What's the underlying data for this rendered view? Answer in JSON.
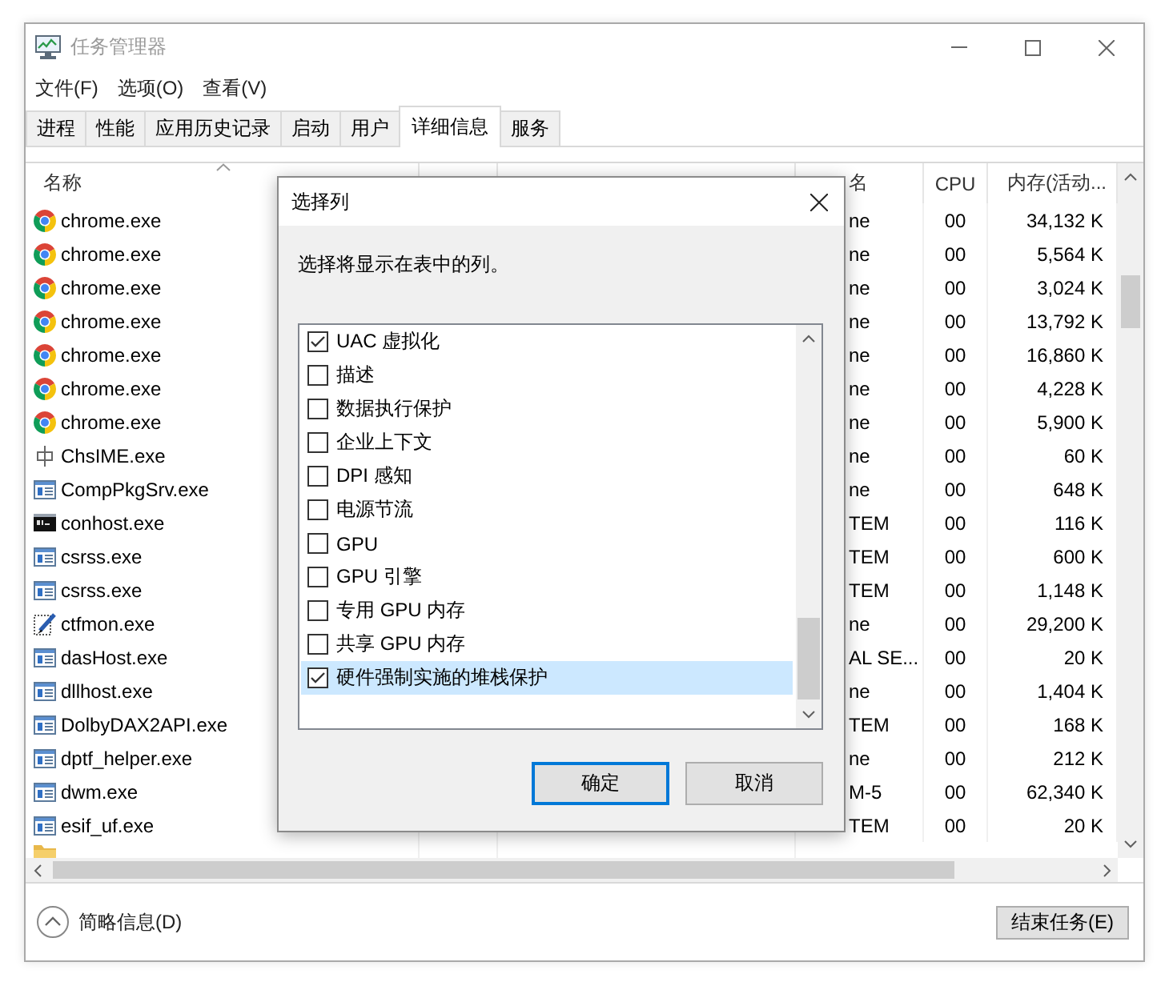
{
  "window": {
    "title": "任务管理器"
  },
  "menu": [
    "文件(F)",
    "选项(O)",
    "查看(V)"
  ],
  "tabs": [
    {
      "label": "进程",
      "selected": false
    },
    {
      "label": "性能",
      "selected": false
    },
    {
      "label": "应用历史记录",
      "selected": false
    },
    {
      "label": "启动",
      "selected": false
    },
    {
      "label": "用户",
      "selected": false
    },
    {
      "label": "详细信息",
      "selected": true
    },
    {
      "label": "服务",
      "selected": false
    }
  ],
  "table": {
    "columns": [
      {
        "label": "名称",
        "sorted": true
      },
      {
        "label": "名",
        "sorted": false
      },
      {
        "label": "CPU",
        "sorted": false
      },
      {
        "label": "内存(活动...",
        "sorted": false
      }
    ],
    "rows": [
      {
        "kind": "chrome",
        "cells": [
          "chrome.exe",
          "ne",
          "00",
          "34,132 K"
        ]
      },
      {
        "kind": "chrome",
        "cells": [
          "chrome.exe",
          "ne",
          "00",
          "5,564 K"
        ]
      },
      {
        "kind": "chrome",
        "cells": [
          "chrome.exe",
          "ne",
          "00",
          "3,024 K"
        ]
      },
      {
        "kind": "chrome",
        "cells": [
          "chrome.exe",
          "ne",
          "00",
          "13,792 K"
        ]
      },
      {
        "kind": "chrome",
        "cells": [
          "chrome.exe",
          "ne",
          "00",
          "16,860 K"
        ]
      },
      {
        "kind": "chrome",
        "cells": [
          "chrome.exe",
          "ne",
          "00",
          "4,228 K"
        ]
      },
      {
        "kind": "chrome",
        "cells": [
          "chrome.exe",
          "ne",
          "00",
          "5,900 K"
        ]
      },
      {
        "kind": "ime",
        "cells": [
          "ChsIME.exe",
          "ne",
          "00",
          "60 K"
        ]
      },
      {
        "kind": "app",
        "cells": [
          "CompPkgSrv.exe",
          "ne",
          "00",
          "648 K"
        ]
      },
      {
        "kind": "console",
        "cells": [
          "conhost.exe",
          "TEM",
          "00",
          "116 K"
        ]
      },
      {
        "kind": "app",
        "cells": [
          "csrss.exe",
          "TEM",
          "00",
          "600 K"
        ]
      },
      {
        "kind": "app",
        "cells": [
          "csrss.exe",
          "TEM",
          "00",
          "1,148 K"
        ]
      },
      {
        "kind": "pen",
        "cells": [
          "ctfmon.exe",
          "ne",
          "00",
          "29,200 K"
        ]
      },
      {
        "kind": "app",
        "cells": [
          "dasHost.exe",
          "AL SE...",
          "00",
          "20 K"
        ]
      },
      {
        "kind": "app",
        "cells": [
          "dllhost.exe",
          "ne",
          "00",
          "1,404 K"
        ]
      },
      {
        "kind": "app",
        "cells": [
          "DolbyDAX2API.exe",
          "TEM",
          "00",
          "168 K"
        ]
      },
      {
        "kind": "app",
        "cells": [
          "dptf_helper.exe",
          "ne",
          "00",
          "212 K"
        ]
      },
      {
        "kind": "app",
        "cells": [
          "dwm.exe",
          "M-5",
          "00",
          "62,340 K"
        ]
      },
      {
        "kind": "app",
        "cells": [
          "esif_uf.exe",
          "TEM",
          "00",
          "20 K"
        ]
      },
      {
        "kind": "folder"
      }
    ]
  },
  "dialog": {
    "title": "选择列",
    "prompt": "选择将显示在表中的列。",
    "options": [
      {
        "label": "UAC 虚拟化",
        "checked": true,
        "selected": false
      },
      {
        "label": "描述",
        "checked": false,
        "selected": false
      },
      {
        "label": "数据执行保护",
        "checked": false,
        "selected": false
      },
      {
        "label": "企业上下文",
        "checked": false,
        "selected": false
      },
      {
        "label": "DPI 感知",
        "checked": false,
        "selected": false
      },
      {
        "label": "电源节流",
        "checked": false,
        "selected": false
      },
      {
        "label": "GPU",
        "checked": false,
        "selected": false
      },
      {
        "label": "GPU 引擎",
        "checked": false,
        "selected": false
      },
      {
        "label": "专用 GPU 内存",
        "checked": false,
        "selected": false
      },
      {
        "label": "共享 GPU 内存",
        "checked": false,
        "selected": false
      },
      {
        "label": "硬件强制实施的堆栈保护",
        "checked": true,
        "selected": true
      }
    ],
    "buttons": [
      {
        "label": "确定",
        "default": true
      },
      {
        "label": "取消",
        "default": false
      }
    ]
  },
  "footer": {
    "details": "简略信息(D)",
    "end_task": "结束任务(E)"
  }
}
